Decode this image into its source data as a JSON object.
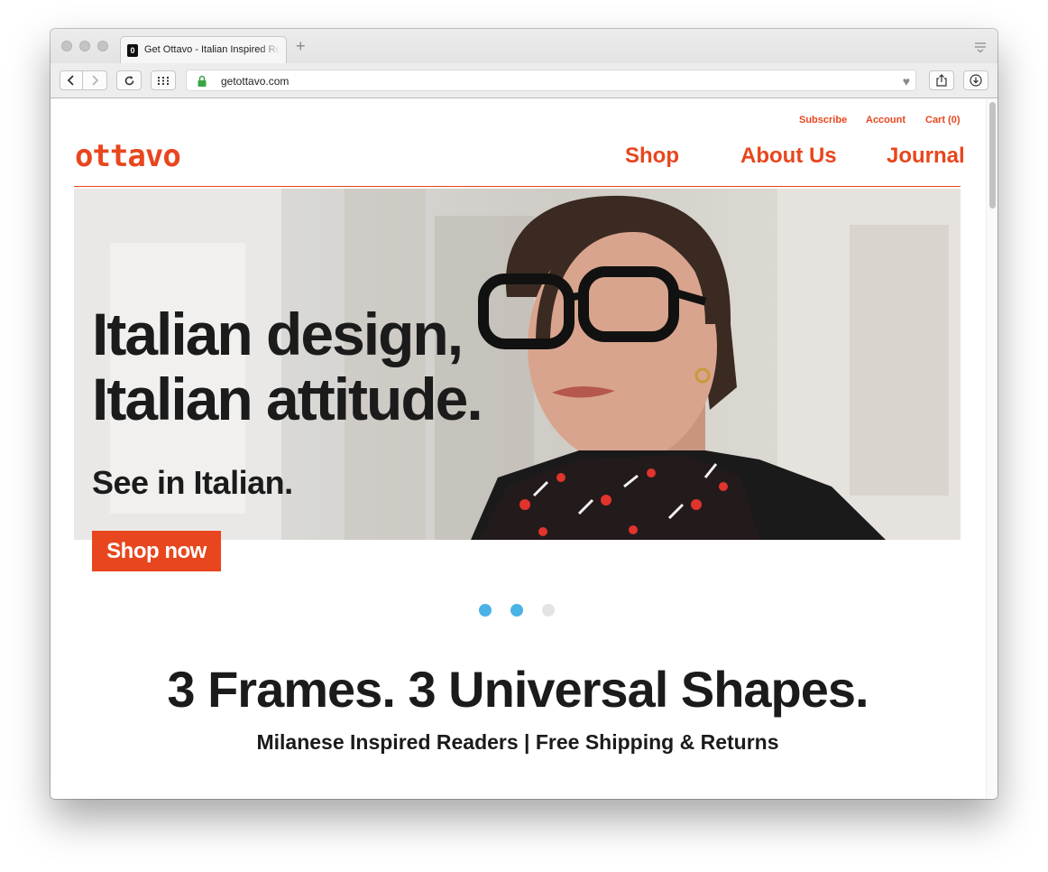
{
  "browser": {
    "tab_title": "Get Ottavo - Italian Inspired Readers",
    "favicon_letter": "0",
    "new_tab_symbol": "+",
    "url": "getottavo.com"
  },
  "site": {
    "utility_links": {
      "subscribe": "Subscribe",
      "account": "Account",
      "cart": "Cart (0)"
    },
    "logo": "ottavo",
    "nav": {
      "shop": "Shop",
      "about": "About Us",
      "journal": "Journal"
    },
    "brand_color": "#e8461e"
  },
  "hero": {
    "line1": "Italian design,",
    "line2": "Italian attitude.",
    "subline": "See in Italian.",
    "cta": "Shop now"
  },
  "carousel": {
    "slides": 3,
    "active_color": "#4ab3e6",
    "inactive_color": "#e4e4e4"
  },
  "section": {
    "headline": "3 Frames. 3 Universal Shapes.",
    "subheadline": "Milanese Inspired Readers | Free Shipping & Returns"
  }
}
